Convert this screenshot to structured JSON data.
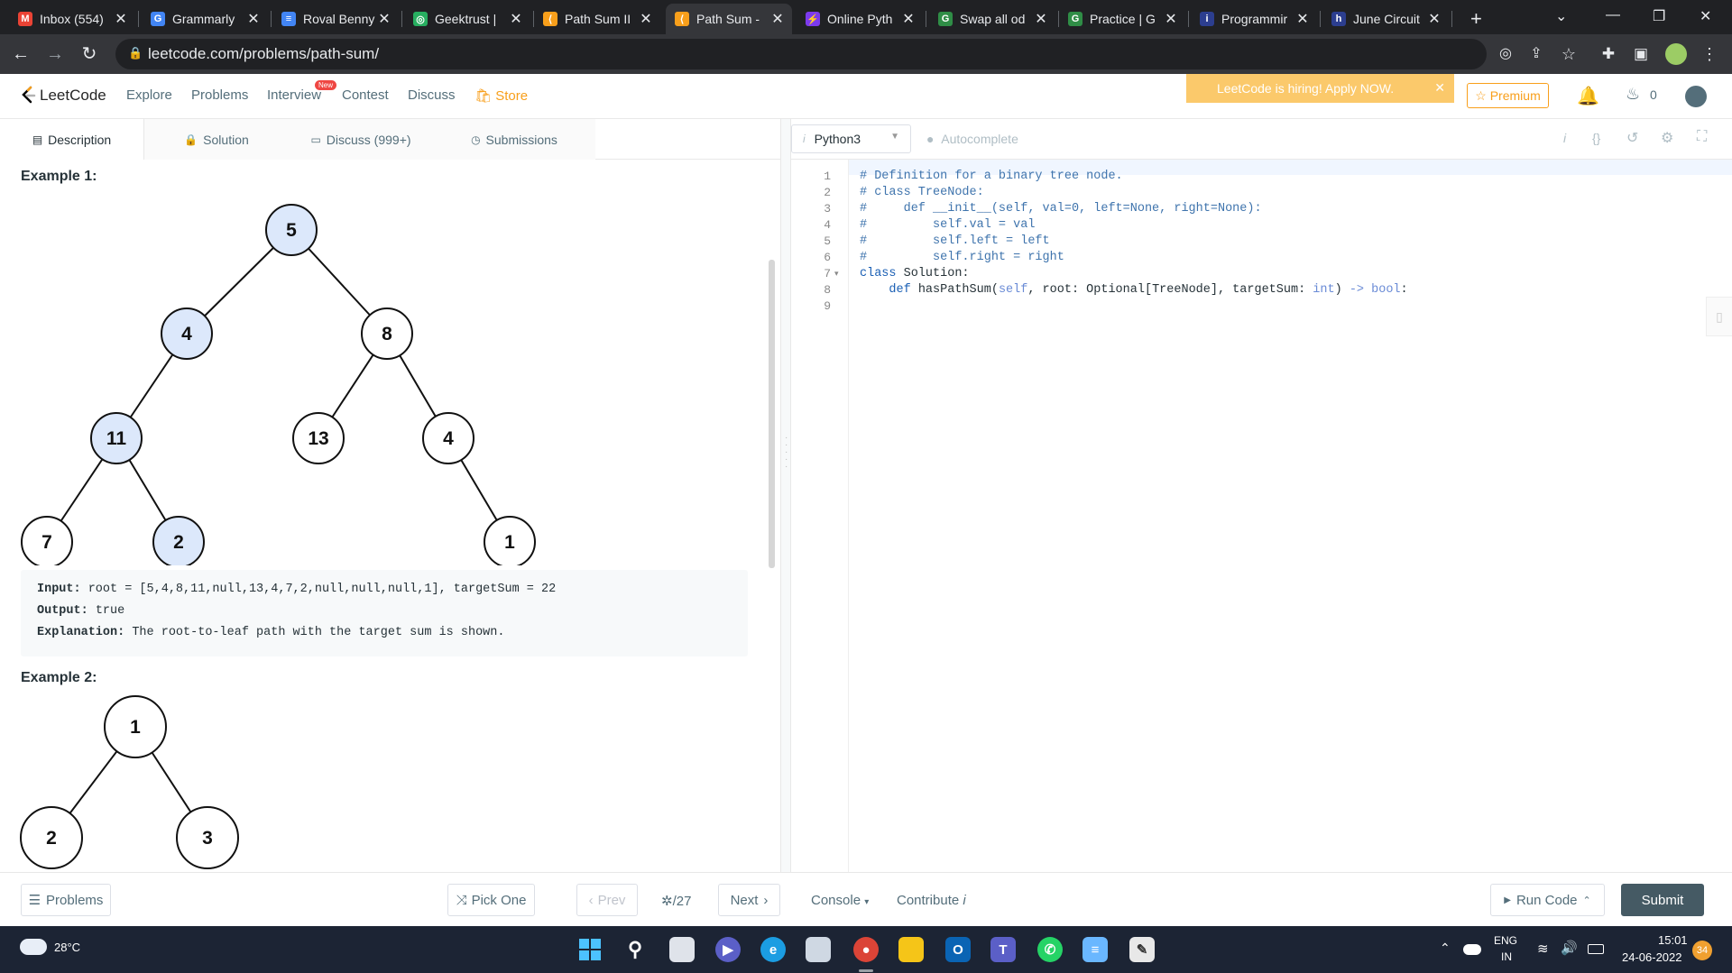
{
  "browser": {
    "tabs": [
      {
        "label": "Inbox (554)",
        "icon": "gmail-icon",
        "color": "#ea4335",
        "glyph": "M"
      },
      {
        "label": "Grammarly",
        "icon": "chrome-icon",
        "color": "#4285f4",
        "glyph": "G"
      },
      {
        "label": "Roval Benny",
        "icon": "docs-icon",
        "color": "#4285f4",
        "glyph": "≡"
      },
      {
        "label": "Geektrust | ",
        "icon": "geektrust-icon",
        "color": "#27ae60",
        "glyph": "◎"
      },
      {
        "label": "Path Sum II",
        "icon": "leetcode-icon",
        "color": "#f89f1b",
        "glyph": "⟨"
      },
      {
        "label": "Path Sum - ",
        "icon": "leetcode-icon",
        "color": "#f89f1b",
        "glyph": "⟨"
      },
      {
        "label": "Online Pyth",
        "icon": "replit-icon",
        "color": "#7c3aed",
        "glyph": "⚡"
      },
      {
        "label": "Swap all od",
        "icon": "gfg-icon",
        "color": "#2f8d46",
        "glyph": "G"
      },
      {
        "label": "Practice | G",
        "icon": "gfg-icon",
        "color": "#2f8d46",
        "glyph": "G"
      },
      {
        "label": "Programmir",
        "icon": "interviewbit-icon",
        "color": "#2c3e8f",
        "glyph": "i"
      },
      {
        "label": "June Circuit",
        "icon": "hackerearth-icon",
        "color": "#2c3e8f",
        "glyph": "h"
      }
    ],
    "new_tab_label": "+",
    "url": "leetcode.com/problems/path-sum/"
  },
  "header": {
    "logo_text": "LeetCode",
    "nav": [
      "Explore",
      "Problems",
      "Interview",
      "Contest",
      "Discuss"
    ],
    "new_badge": "New",
    "store": "Store",
    "hiring_banner": "LeetCode is hiring! Apply NOW.",
    "premium": "Premium",
    "points": "0"
  },
  "left_tabs": [
    "Description",
    "Solution",
    "Discuss (999+)",
    "Submissions"
  ],
  "example1": {
    "heading": "Example 1:",
    "nodes": [
      "5",
      "4",
      "8",
      "11",
      "13",
      "4",
      "7",
      "2",
      "1"
    ],
    "highlighted": [
      true,
      true,
      false,
      true,
      false,
      false,
      false,
      true,
      false
    ],
    "input_label": "Input:",
    "input_value": " root = [5,4,8,11,null,13,4,7,2,null,null,null,1], targetSum = 22",
    "output_label": "Output:",
    "output_value": " true",
    "explanation_label": "Explanation:",
    "explanation_value": " The root-to-leaf path with the target sum is shown."
  },
  "example2": {
    "heading": "Example 2:",
    "nodes": [
      "1",
      "2",
      "3"
    ]
  },
  "editor": {
    "language": "Python3",
    "autocomplete": "Autocomplete",
    "lines": [
      "# Definition for a binary tree node.",
      "# class TreeNode:",
      "#     def __init__(self, val=0, left=None, right=None):",
      "#         self.val = val",
      "#         self.left = left",
      "#         self.right = right",
      "class Solution:",
      "    def hasPathSum(self, root: Optional[TreeNode], targetSum: int) -> bool:",
      ""
    ]
  },
  "footer": {
    "problems": "Problems",
    "pick_one": "Pick One",
    "prev": "Prev",
    "page": "/27",
    "next": "Next",
    "console": "Console",
    "contribute": "Contribute",
    "run_code": "Run Code",
    "submit": "Submit"
  },
  "taskbar": {
    "weather": "28°C",
    "lang_top": "ENG",
    "lang_bottom": "IN",
    "time": "15:01",
    "date": "24-06-2022",
    "notifications": "34"
  }
}
